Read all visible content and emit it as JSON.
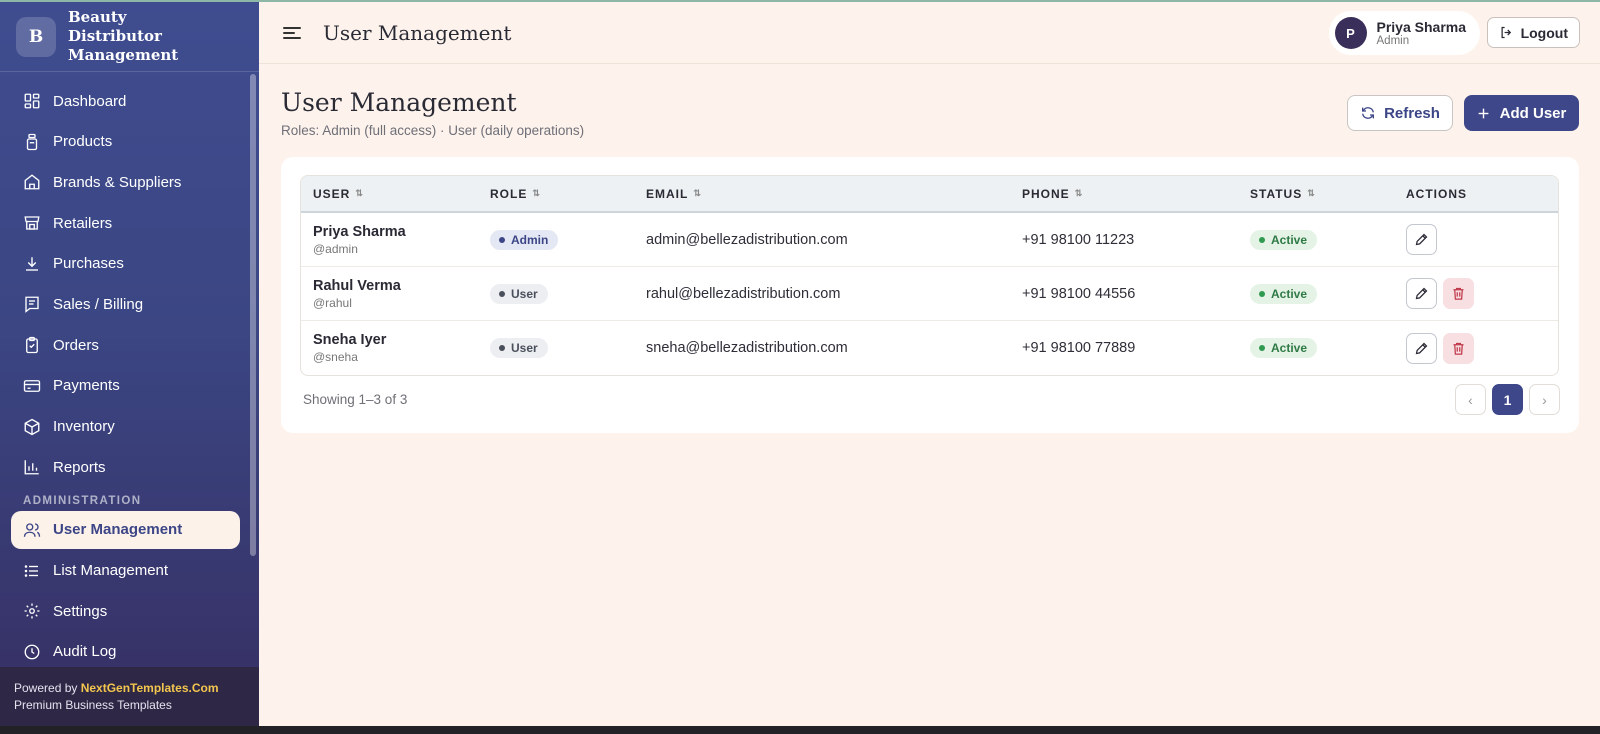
{
  "brand": {
    "logo_letter": "B",
    "title": "Beauty Distributor Management"
  },
  "sidebar": {
    "items": [
      {
        "label": "Dashboard",
        "icon": "dashboard-icon"
      },
      {
        "label": "Products",
        "icon": "bottle-icon"
      },
      {
        "label": "Brands & Suppliers",
        "icon": "store-icon"
      },
      {
        "label": "Retailers",
        "icon": "shop-icon"
      },
      {
        "label": "Purchases",
        "icon": "download-icon"
      },
      {
        "label": "Sales / Billing",
        "icon": "receipt-icon"
      },
      {
        "label": "Orders",
        "icon": "clipboard-icon"
      },
      {
        "label": "Payments",
        "icon": "credit-card-icon"
      },
      {
        "label": "Inventory",
        "icon": "box-icon"
      },
      {
        "label": "Reports",
        "icon": "bar-chart-icon"
      }
    ],
    "section_label": "ADMINISTRATION",
    "admin_items": [
      {
        "label": "User Management",
        "icon": "users-icon",
        "active": true
      },
      {
        "label": "List Management",
        "icon": "list-icon"
      },
      {
        "label": "Settings",
        "icon": "gear-icon"
      },
      {
        "label": "Audit Log",
        "icon": "clock-icon"
      }
    ],
    "footer": {
      "powered_prefix": "Powered by ",
      "powered_brand": "NextGenTemplates.Com",
      "tagline": "Premium Business Templates"
    }
  },
  "topbar": {
    "title": "User Management",
    "user": {
      "initial": "P",
      "name": "Priya Sharma",
      "role": "Admin"
    },
    "logout_label": "Logout"
  },
  "page": {
    "title": "User Management",
    "subtitle": "Roles: Admin (full access) · User (daily operations)",
    "refresh_label": "Refresh",
    "add_label": "Add User"
  },
  "table": {
    "columns": {
      "user": "USER",
      "role": "ROLE",
      "email": "EMAIL",
      "phone": "PHONE",
      "status": "STATUS",
      "actions": "ACTIONS"
    },
    "sort_glyph": "⇅",
    "rows": [
      {
        "name": "Priya Sharma",
        "handle": "@admin",
        "role": "Admin",
        "email": "admin@bellezadistribution.com",
        "phone": "+91 98100 11223",
        "status": "Active",
        "can_delete": false
      },
      {
        "name": "Rahul Verma",
        "handle": "@rahul",
        "role": "User",
        "email": "rahul@bellezadistribution.com",
        "phone": "+91 98100 44556",
        "status": "Active",
        "can_delete": true
      },
      {
        "name": "Sneha Iyer",
        "handle": "@sneha",
        "role": "User",
        "email": "sneha@bellezadistribution.com",
        "phone": "+91 98100 77889",
        "status": "Active",
        "can_delete": true
      }
    ]
  },
  "pagination": {
    "showing": "Showing 1–3 of 3",
    "prev": "‹",
    "current": "1",
    "next": "›"
  },
  "colors": {
    "primary": "#3d4789",
    "background": "#fdf3ec",
    "active_status": "#2f9a50",
    "delete_bg": "#f7dfe2"
  }
}
